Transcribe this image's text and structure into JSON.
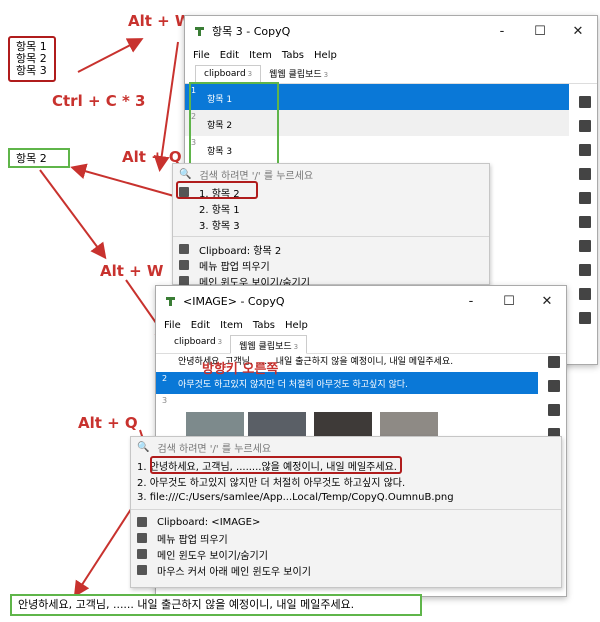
{
  "notes": {
    "items_box": [
      "항목 1",
      "항목 2",
      "항목 3"
    ],
    "paste_box": "항목 2",
    "final_box": "안녕하세요, 고객님, ...... 내일 출근하지 않을 예정이니, 내일 메일주세요."
  },
  "labels": {
    "alt_w_1": "Alt + W",
    "ctrl_c": "Ctrl + C * 3",
    "alt_q_1": "Alt + Q",
    "alt_w_2": "Alt + W",
    "alt_q_2": "Alt + Q",
    "direction_key": "방향키 오른쪽"
  },
  "window1": {
    "title": "항목 3 - CopyQ",
    "controls": [
      "-",
      "☐",
      "✕"
    ],
    "menu": [
      "File",
      "Edit",
      "Item",
      "Tabs",
      "Help"
    ],
    "tabs": [
      {
        "label": "clipboard",
        "count": "3"
      },
      {
        "label": "웹웹 클립보드",
        "count": "3"
      }
    ],
    "items": [
      {
        "num": "1",
        "text": "항목 1"
      },
      {
        "num": "2",
        "text": "항목 2"
      },
      {
        "num": "3",
        "text": "항목 3"
      }
    ]
  },
  "popup1": {
    "search_placeholder": "검색 하려면 '/' 를 누르세요",
    "entries": [
      "1. 항목 2",
      "2. 항목 1",
      "3. 항목 3"
    ],
    "actions": [
      "Clipboard: 항목 2",
      "메뉴 팝업 띄우기",
      "메인 윈도우 보이기/숨기기"
    ]
  },
  "window2": {
    "title": "<IMAGE> - CopyQ",
    "controls": [
      "-",
      "☐",
      "✕"
    ],
    "menu": [
      "File",
      "Edit",
      "Item",
      "Tabs",
      "Help"
    ],
    "tabs": [
      {
        "label": "clipboard",
        "count": "3"
      },
      {
        "label": "웹웹 클립보드",
        "count": "3"
      }
    ],
    "items": [
      {
        "num": "",
        "text": "안녕하세요, 고객님, ...... 내일 출근하지 않을 예정이니, 내일 메일주세요."
      },
      {
        "num": "2",
        "text": "아무것도 하고있지 않지만 더 처절히 아무것도 하고싶지 않다."
      },
      {
        "num": "3",
        "text": ""
      }
    ]
  },
  "popup2": {
    "search_placeholder": "검색 하려면 '/' 를 누르세요",
    "entries": [
      "1. 안녕하세요, 고객님, ........않을 예정이니, 내일 메일주세요.",
      "2. 아무것도 하고있지 않지만 더 처절히 아무것도 하고싶지 않다.",
      "3. file:///C:/Users/samlee/App...Local/Temp/CopyQ.OumnuB.png"
    ],
    "actions": [
      "Clipboard: <IMAGE>",
      "메뉴 팝업 띄우기",
      "메인 윈도우 보이기/숨기기",
      "마우스 커서 아래 메인 윈도우 보이기"
    ]
  },
  "colors": {
    "accent_blue": "#0a78d7",
    "annotation_red": "#c8322e",
    "highlight_green": "#5fb54a"
  }
}
